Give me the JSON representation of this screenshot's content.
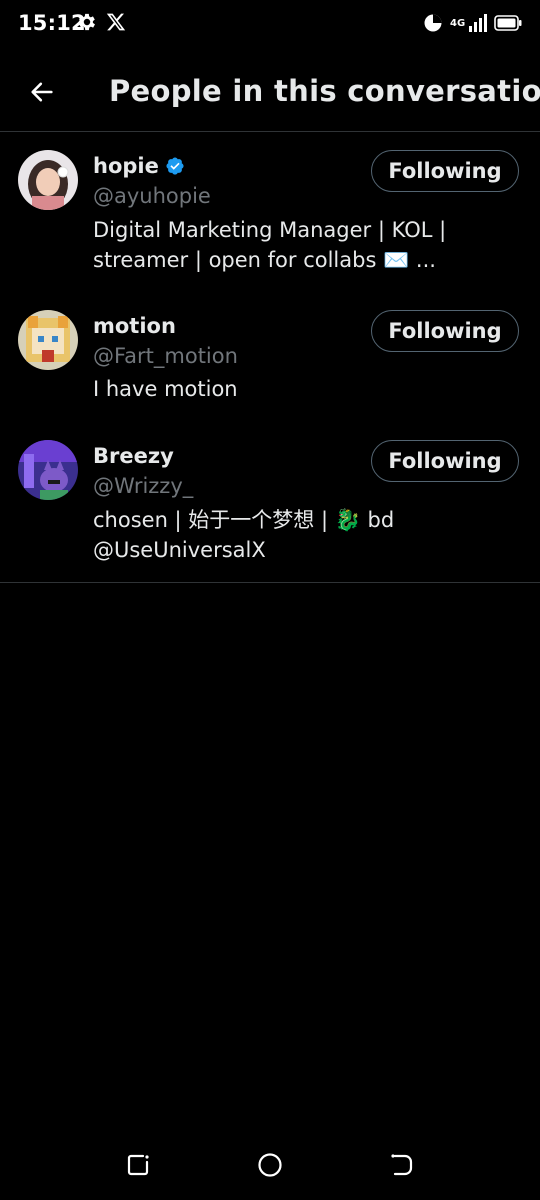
{
  "status_bar": {
    "time": "15:12",
    "network": "4G",
    "icons": [
      "gear-icon",
      "x-logo-icon",
      "data-saver-icon",
      "signal-icon",
      "battery-icon"
    ]
  },
  "header": {
    "back_icon": "arrow-left-icon",
    "title": "People in this conversation"
  },
  "people": [
    {
      "name": "hopie",
      "verified": true,
      "handle": "@ayuhopie",
      "bio_lines": [
        "Digital Marketing Manager | KOL |",
        "streamer | open for collabs ✉️ ..."
      ],
      "button_label": "Following"
    },
    {
      "name": "motion",
      "verified": false,
      "handle": "@Fart_motion",
      "bio_lines": [
        "I have motion"
      ],
      "button_label": "Following"
    },
    {
      "name": "Breezy",
      "verified": false,
      "handle": "@Wrizzy_",
      "bio_lines": [
        "chosen | 始于一个梦想 | 🐉 bd",
        "@UseUniversalX"
      ],
      "button_label": "Following"
    }
  ],
  "nav_bar": {
    "icons": [
      "recents-icon",
      "home-circle-icon",
      "back-nav-icon"
    ]
  },
  "colors": {
    "background": "#000000",
    "text_primary": "#e7e9ea",
    "text_secondary": "#71767b",
    "divider": "#2f3336",
    "verified_blue": "#1d9bf0"
  }
}
